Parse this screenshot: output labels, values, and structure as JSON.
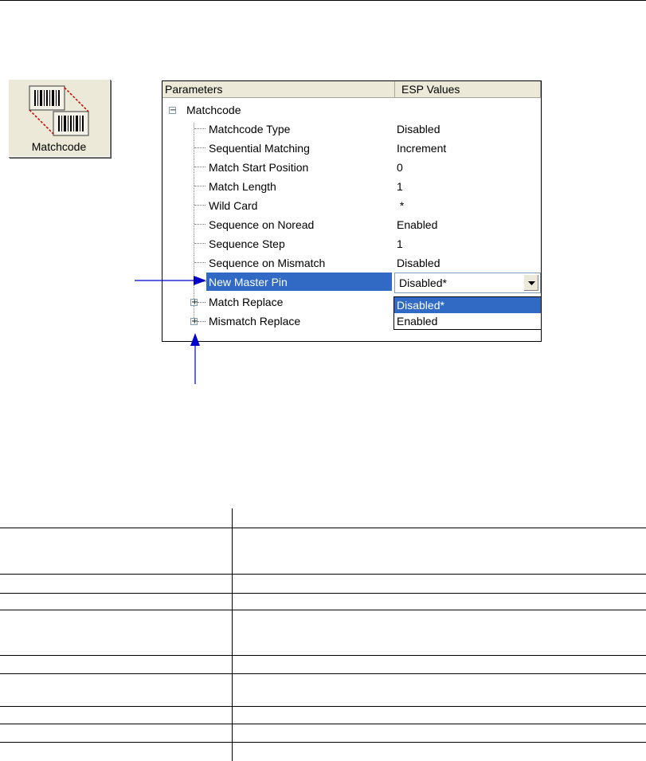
{
  "toolbar": {
    "matchcode_button_label": "Matchcode"
  },
  "tree": {
    "columns": {
      "parameters": "Parameters",
      "esp_values": "ESP Values"
    },
    "root": {
      "label": "Matchcode",
      "expander": "−"
    },
    "rows": [
      {
        "label": "Matchcode Type",
        "value": "Disabled"
      },
      {
        "label": "Sequential Matching",
        "value": "Increment"
      },
      {
        "label": "Match Start Position",
        "value": "0"
      },
      {
        "label": "Match Length",
        "value": "1"
      },
      {
        "label": "Wild Card",
        "value": " *"
      },
      {
        "label": "Sequence on Noread",
        "value": "Enabled"
      },
      {
        "label": "Sequence Step",
        "value": "1"
      },
      {
        "label": "Sequence on Mismatch",
        "value": "Disabled"
      }
    ],
    "selected_row": {
      "label": "New Master Pin"
    },
    "collapsed": [
      {
        "label": "Match Replace",
        "expander": "+"
      },
      {
        "label": "Mismatch Replace",
        "expander": "+"
      }
    ],
    "combo": {
      "value": "Disabled*",
      "options": [
        "Disabled*",
        "Enabled"
      ]
    }
  },
  "colors": {
    "selection": "#316ac5",
    "arrow": "#0000cc",
    "button_face": "#ece9d8"
  },
  "icons": {
    "matchcode_button": "matchcode-barcode-icon",
    "combo_dropdown": "chevron-down-icon"
  }
}
